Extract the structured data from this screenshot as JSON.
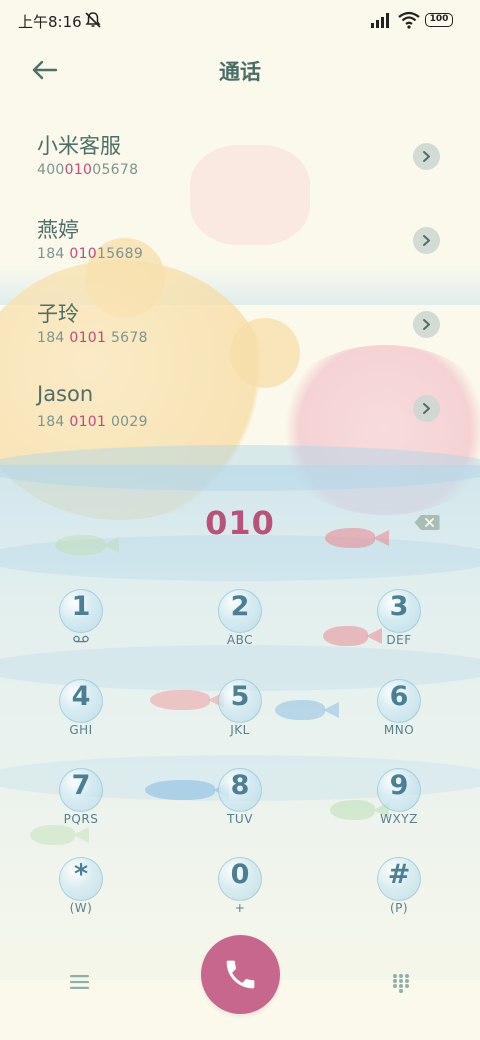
{
  "status_bar": {
    "time": "上午8:16",
    "battery": "100",
    "icons": [
      "mute-bell-icon",
      "signal-icon",
      "wifi-icon",
      "battery-icon"
    ]
  },
  "header": {
    "title": "通话",
    "back_icon": "back-arrow-icon"
  },
  "contacts": [
    {
      "name": "小米客服",
      "number_pre": "400",
      "number_hl": "010",
      "number_post": "05678"
    },
    {
      "name": "燕婷",
      "number_pre": "184 ",
      "number_hl": "010",
      "number_post": "15689"
    },
    {
      "name": "子玲",
      "number_pre": "184 ",
      "number_hl": "0101",
      "number_post": " 5678"
    },
    {
      "name": "Jason",
      "number_pre": "184 ",
      "number_hl": "0101",
      "number_post": " 0029"
    }
  ],
  "dial": {
    "digits": "010",
    "backspace_icon": "backspace-icon"
  },
  "keypad": [
    {
      "digit": "1",
      "letters": ""
    },
    {
      "digit": "2",
      "letters": "ABC"
    },
    {
      "digit": "3",
      "letters": "DEF"
    },
    {
      "digit": "4",
      "letters": "GHI"
    },
    {
      "digit": "5",
      "letters": "JKL"
    },
    {
      "digit": "6",
      "letters": "MNO"
    },
    {
      "digit": "7",
      "letters": "PQRS"
    },
    {
      "digit": "8",
      "letters": "TUV"
    },
    {
      "digit": "9",
      "letters": "WXYZ"
    },
    {
      "digit": "*",
      "letters": "(W)"
    },
    {
      "digit": "0",
      "letters": "+"
    },
    {
      "digit": "#",
      "letters": "(P)"
    }
  ],
  "bottom_bar": {
    "menu_icon": "menu-icon",
    "call_icon": "phone-icon",
    "keypad_icon": "dialpad-icon"
  },
  "colors": {
    "accent": "#c7678e",
    "highlight": "#c24a78",
    "text": "#4f6f66",
    "key_digit": "#4c7e94"
  }
}
